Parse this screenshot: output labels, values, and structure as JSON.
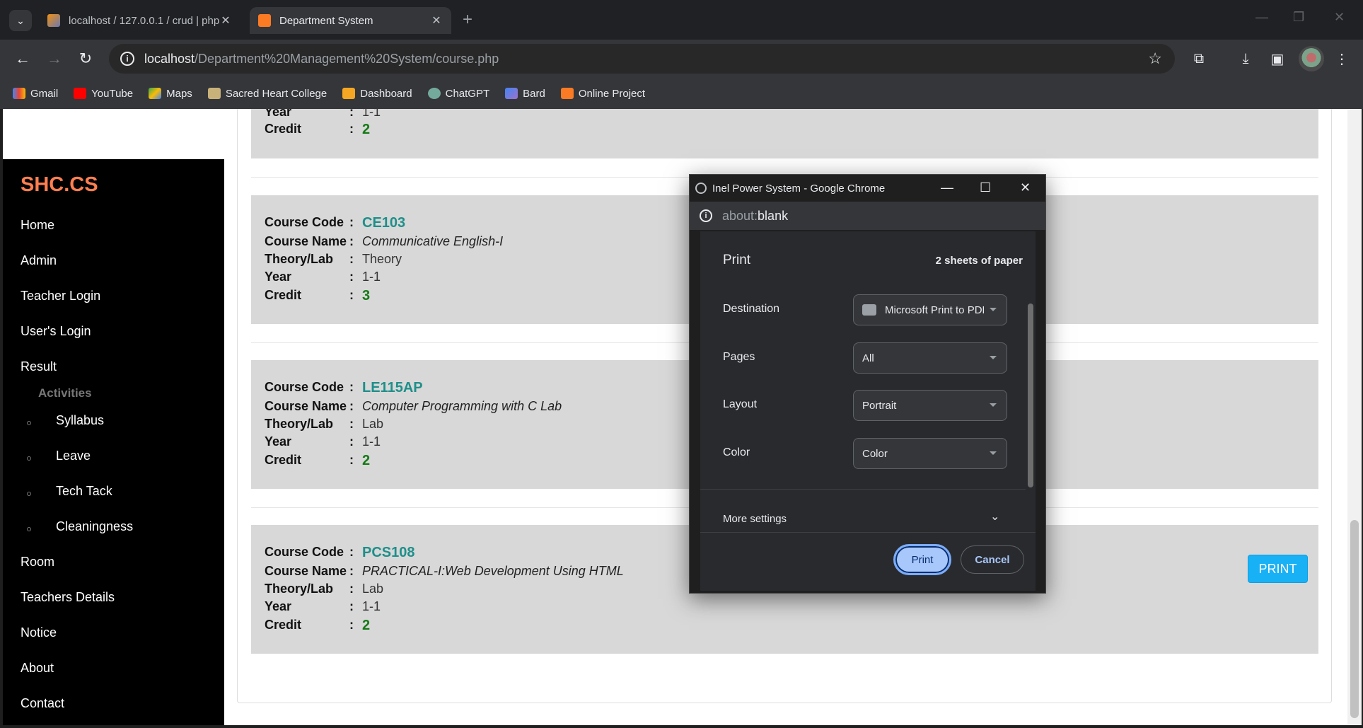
{
  "browser": {
    "tabs": [
      {
        "label": "localhost / 127.0.0.1 / crud | php",
        "active": false
      },
      {
        "label": "Department System",
        "active": true
      }
    ],
    "url_host": "localhost",
    "url_path": "/Department%20Management%20System/course.php",
    "bookmarks": [
      "Gmail",
      "YouTube",
      "Maps",
      "Sacred Heart College",
      "Dashboard",
      "ChatGPT",
      "Bard",
      "Online Project"
    ]
  },
  "sidebar": {
    "brand": "SHC.CS",
    "items": [
      "Home",
      "Admin",
      "Teacher Login",
      "User's Login",
      "Result"
    ],
    "activities_title": "Activities",
    "activities": [
      "Syllabus",
      "Leave",
      "Tech Tack",
      "Cleaningness"
    ],
    "items_after": [
      "Room",
      "Teachers Details",
      "Notice",
      "About",
      "Contact"
    ]
  },
  "labels": {
    "code": "Course Code",
    "name": "Course Name",
    "type": "Theory/Lab",
    "year": "Year",
    "credit": "Credit",
    "colon": ":"
  },
  "top_partial": {
    "year": "1-1",
    "credit": "2"
  },
  "courses": [
    {
      "code": "CE103",
      "name": "Communicative English-I",
      "type": "Theory",
      "year": "1-1",
      "credit": "3"
    },
    {
      "code": "LE115AP",
      "name": "Computer Programming with C Lab",
      "type": "Lab",
      "year": "1-1",
      "credit": "2"
    },
    {
      "code": "PCS108",
      "name": "PRACTICAL-I:Web Development Using HTML",
      "type": "Lab",
      "year": "1-1",
      "credit": "2"
    }
  ],
  "print_button": "PRINT",
  "popup": {
    "title": "Inel Power System - Google Chrome",
    "url_scheme": "about:",
    "url_rest": "blank",
    "print_title": "Print",
    "sheets": "2 sheets of paper",
    "fields": [
      {
        "label": "Destination",
        "value": "Microsoft Print to PDF"
      },
      {
        "label": "Pages",
        "value": "All"
      },
      {
        "label": "Layout",
        "value": "Portrait"
      },
      {
        "label": "Color",
        "value": "Color"
      }
    ],
    "more_settings": "More settings",
    "print_label": "Print",
    "cancel_label": "Cancel"
  }
}
